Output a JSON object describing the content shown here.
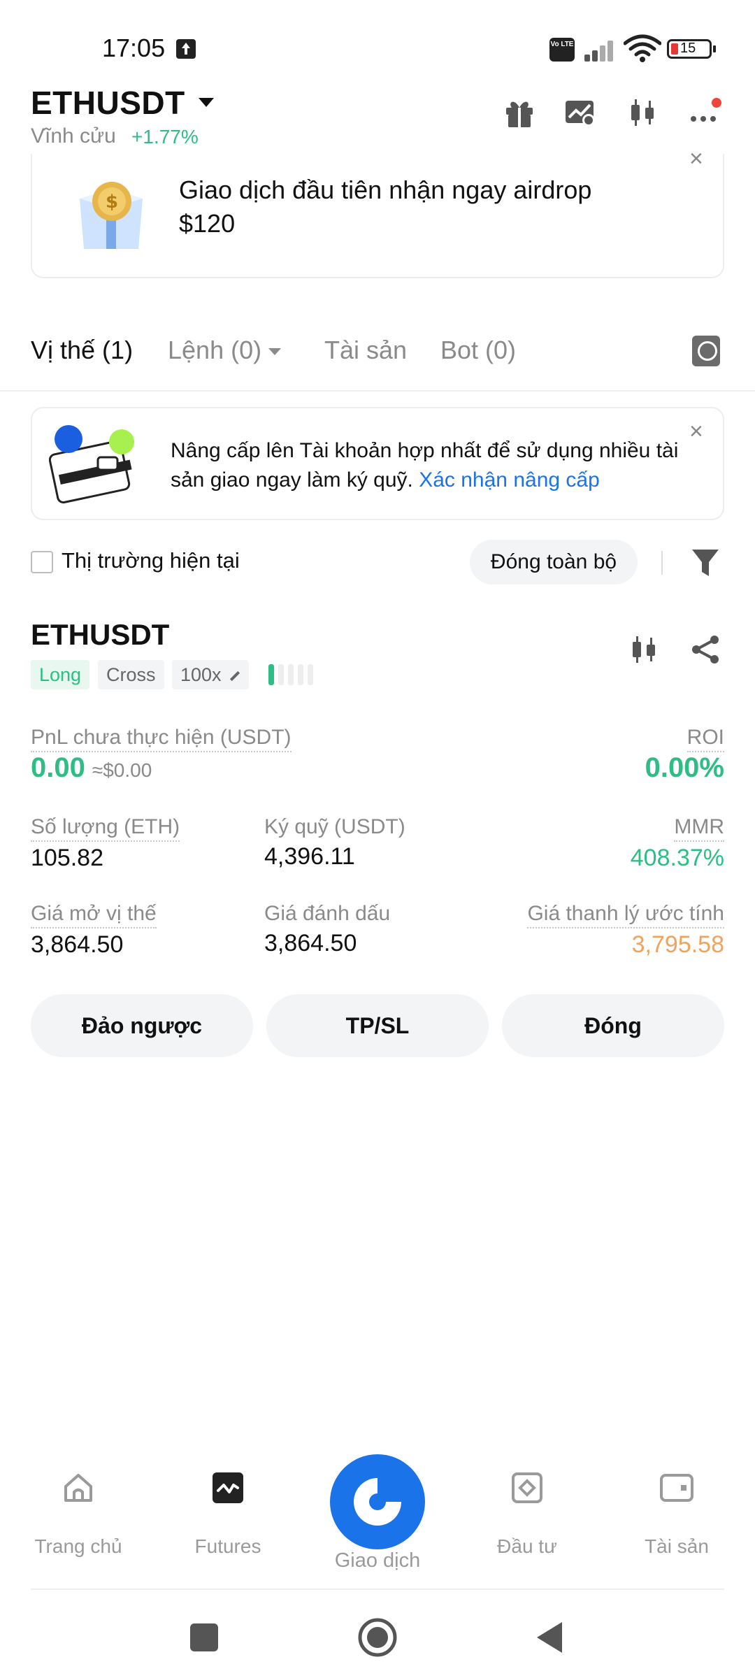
{
  "status_bar": {
    "time": "17:05",
    "network_badge": "Vo LTE",
    "battery_level": "15"
  },
  "header": {
    "pair": "ETHUSDT",
    "contract_type": "Vĩnh cửu",
    "change": "+1.77%"
  },
  "promo": {
    "line1": "Giao dịch đầu tiên nhận ngay airdrop",
    "line2": "$120"
  },
  "tabs": [
    {
      "label": "Vị thế (1)"
    },
    {
      "label": "Lệnh (0)"
    },
    {
      "label": "Tài sản"
    },
    {
      "label": "Bot (0)"
    }
  ],
  "upgrade": {
    "text": "Nâng cấp lên Tài khoản hợp nhất để sử dụng nhiều tài sản giao ngay làm ký quỹ.",
    "link": "Xác nhận nâng cấp"
  },
  "filter": {
    "checkbox_label": "Thị trường hiện tại",
    "close_all": "Đóng toàn bộ"
  },
  "position": {
    "symbol": "ETHUSDT",
    "side": "Long",
    "margin_mode": "Cross",
    "leverage": "100x",
    "pnl_label": "PnL chưa thực hiện (USDT)",
    "pnl_value": "0.00",
    "pnl_approx": "≈$0.00",
    "roi_label": "ROI",
    "roi_value": "0.00%",
    "qty_label": "Số lượng (ETH)",
    "qty_value": "105.82",
    "margin_label": "Ký quỹ (USDT)",
    "margin_value": "4,396.11",
    "mmr_label": "MMR",
    "mmr_value": "408.37%",
    "entry_label": "Giá mở vị thế",
    "entry_value": "3,864.50",
    "mark_label": "Giá đánh dấu",
    "mark_value": "3,864.50",
    "liq_label": "Giá thanh lý ước tính",
    "liq_value": "3,795.58"
  },
  "actions": {
    "reverse": "Đảo ngược",
    "tpsl": "TP/SL",
    "close": "Đóng"
  },
  "bottom_nav": [
    {
      "label": "Trang chủ"
    },
    {
      "label": "Futures"
    },
    {
      "label": "Giao dịch"
    },
    {
      "label": "Đầu tư"
    },
    {
      "label": "Tài sản"
    }
  ],
  "colors": {
    "accent": "#1a73e8",
    "positive": "#2ebd85",
    "warning": "#f0a35c",
    "alert": "#f04438"
  }
}
